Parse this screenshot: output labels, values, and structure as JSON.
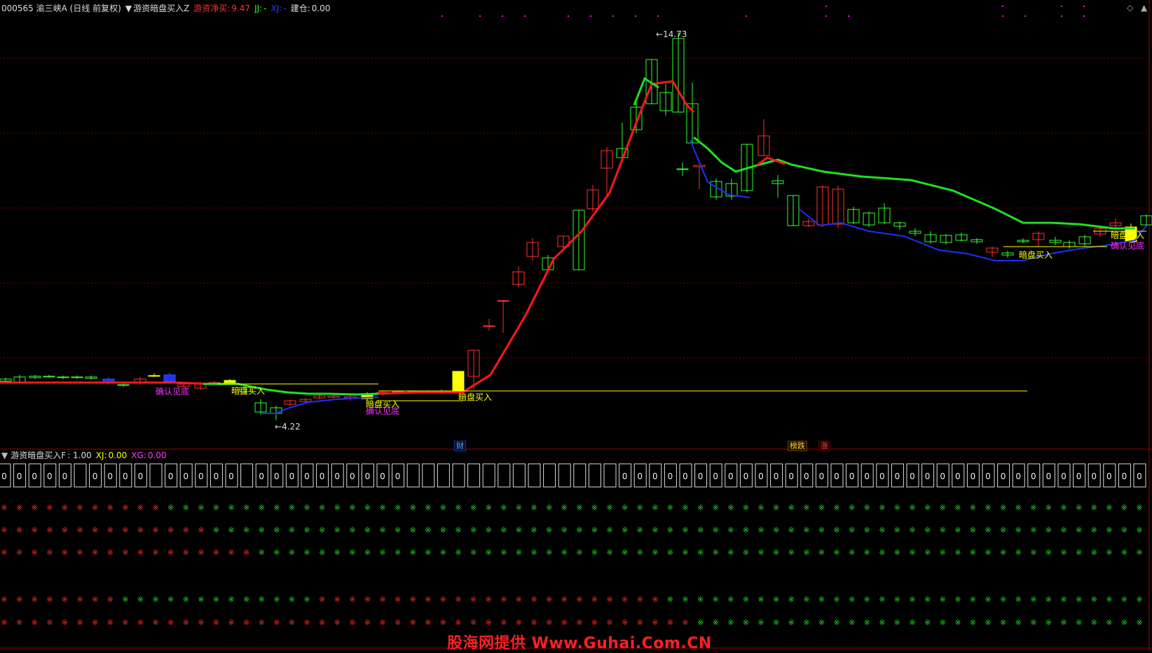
{
  "header": {
    "symbol": "000565 渝三峡A (日线 前复权)",
    "indicator_name": "游资暗盘买入Z",
    "net_buy_label": "游资净买:",
    "net_buy_value": "9.47",
    "jj_label": "JJ:",
    "jj_value": "-",
    "xj_label": "XJ:",
    "xj_value": "-",
    "position_label": "建仓:",
    "position_value": "0.00"
  },
  "sub_header": {
    "indicator_name": "游资暗盘买入F",
    "f_value": ": 1.00",
    "xj_label": "XJ:",
    "xj_value": "0.00",
    "xg_label": "XG:",
    "xg_value": "0.00"
  },
  "price_labels": {
    "high": "14.73",
    "low": "4.22"
  },
  "annotations": {
    "confirm_bottom": "确认见底",
    "dark_buy": "暗盘买入"
  },
  "tags": {
    "cai": "财",
    "bang_die": "榜跌",
    "zhang": "涨"
  },
  "box_value": "0",
  "dot_glyph": "※",
  "colors": {
    "up": "#ff3030",
    "down": "#30ff30",
    "ma_red": "#ff1818",
    "ma_green": "#20e020",
    "ma_blue": "#2030ff",
    "yellow": "#ffff00",
    "grid": "#8b0000",
    "magenta": "#ff30ff"
  },
  "watermark": "股海网提供 Www.Guhai.Com.CN"
}
